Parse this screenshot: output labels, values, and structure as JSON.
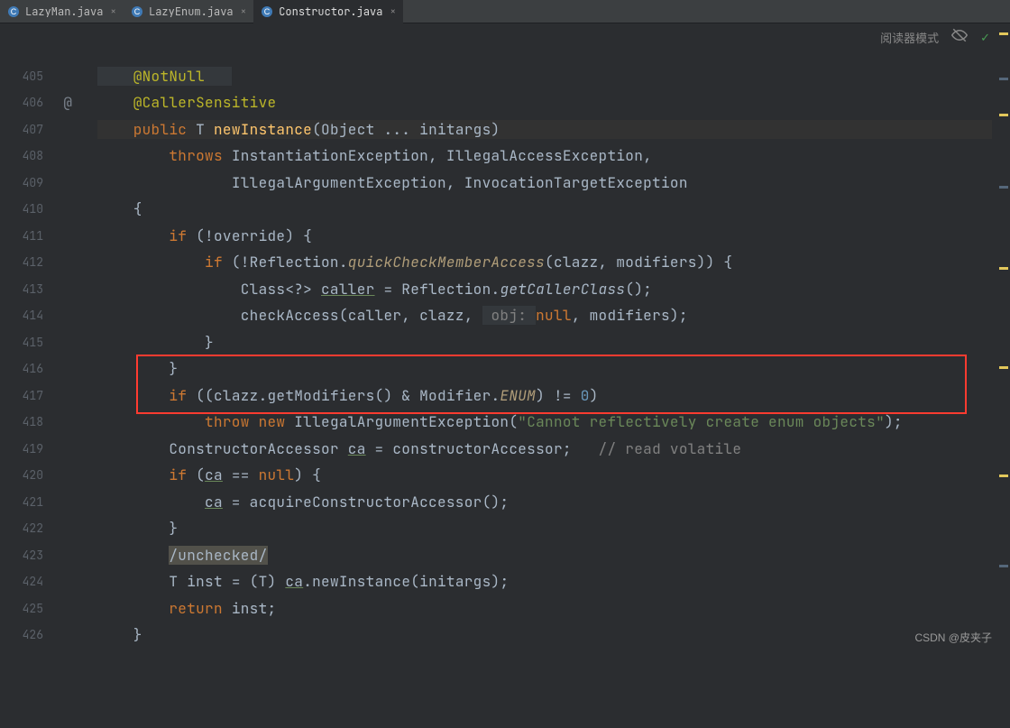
{
  "tabs": {
    "t0": {
      "label": "LazyMan.java"
    },
    "t1": {
      "label": "LazyEnum.java"
    },
    "t2": {
      "label": "Constructor.java"
    }
  },
  "topbar": {
    "reader_mode": "阅读器模式"
  },
  "gutter": {
    "l0": "405",
    "l1": "406",
    "l2": "407",
    "l3": "408",
    "l4": "409",
    "l5": "410",
    "l6": "411",
    "l7": "412",
    "l8": "413",
    "l9": "414",
    "l10": "415",
    "l11": "416",
    "l12": "417",
    "l13": "418",
    "l14": "419",
    "l15": "420",
    "l16": "421",
    "l17": "422",
    "l18": "423",
    "l19": "424",
    "l20": "425",
    "l21": "426"
  },
  "marks": {
    "at": "@"
  },
  "code": {
    "notnull": "@NotNull",
    "caller_sensitive": "@CallerSensitive",
    "public": "public",
    "T": "T",
    "newInstance": "newInstance",
    "sigtail": "(Object ... initargs)",
    "throws": "throws",
    "ex1": "InstantiationException, IllegalAccessException,",
    "ex2": "IllegalArgumentException, InvocationTargetException",
    "open": "{",
    "close": "}",
    "if": "if",
    "not_override": " (!override) {",
    "refl_chk_pre": " (!Reflection.",
    "quickCheckMemberAccess": "quickCheckMemberAccess",
    "refl_chk_post": "(clazz, modifiers)) {",
    "class_decl": "Class<?> ",
    "caller": "caller",
    "eq_refl": " = Reflection.",
    "getCallerClass": "getCallerClass",
    "paren_semi": "();",
    "checkAccess": "checkAccess(caller, clazz, ",
    "obj_hint": " obj: ",
    "null_kw": "null",
    "mods_tail": ", modifiers);",
    "cond_enum_pre": " ((clazz.getModifiers() & Modifier.",
    "ENUM": "ENUM",
    "cond_enum_post": ") != ",
    "zero": "0",
    "cond_close": ")",
    "throw": "throw",
    "new": "new",
    "iaex": "IllegalArgumentException(",
    "msg": "\"Cannot reflectively create enum objects\"",
    "end_throw": ");",
    "ctor_acc_decl": "ConstructorAccessor ",
    "ca": "ca",
    "eq_ctor": " = constructorAccessor;   ",
    "cm_read": "// read volatile",
    "ca_null": " == ",
    "open_br": ") {",
    "acquire": " = acquireConstructorAccessor();",
    "unchecked": "/unchecked/",
    "T2": "T",
    "inst": "inst",
    "cast": " = (",
    "cast2": ") ",
    "newInst": ".newInstance(initargs);",
    "return": "return",
    "inst_semi": " inst;"
  },
  "watermark": "CSDN @皮夹子"
}
